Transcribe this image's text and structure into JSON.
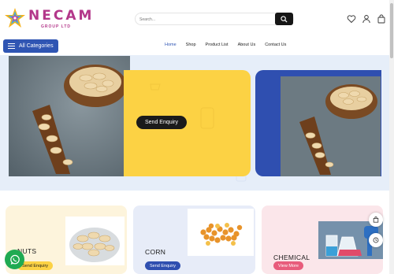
{
  "header": {
    "brand": "NECAM",
    "brand_sub": "GROUP LTD",
    "search_placeholder": "Search...",
    "icons": [
      "search-icon",
      "heart-icon",
      "user-icon",
      "bag-icon"
    ]
  },
  "nav": {
    "categories_label": "All Categories",
    "links": [
      "Home",
      "Shop",
      "Product List",
      "About Us",
      "Contact Us"
    ],
    "active": "Home"
  },
  "hero": {
    "enquiry_label": "Send Enquiry"
  },
  "cards": [
    {
      "title": "NUTS",
      "button": "Send Enquiry"
    },
    {
      "title": "CORN",
      "button": "Send Enquiry"
    },
    {
      "title": "CHEMICAL",
      "button": "View More"
    }
  ],
  "colors": {
    "brand": "#b3378a",
    "accent_blue": "#2f55b3",
    "yellow": "#fcd244",
    "whatsapp": "#1faa52"
  }
}
